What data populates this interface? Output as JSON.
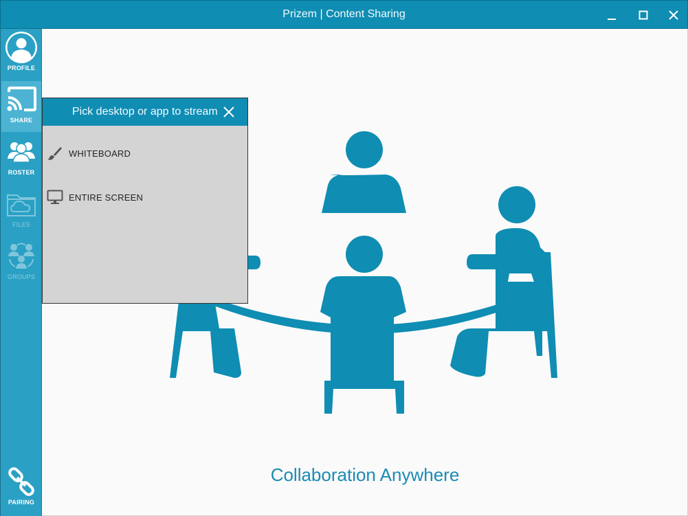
{
  "window": {
    "title": "Prizem | Content Sharing"
  },
  "sidebar": {
    "items": [
      {
        "label": "PROFILE",
        "icon": "profile-icon"
      },
      {
        "label": "SHARE",
        "icon": "cast-icon"
      },
      {
        "label": "ROSTER",
        "icon": "roster-icon"
      },
      {
        "label": "FILES",
        "icon": "cloud-folder-icon"
      },
      {
        "label": "GROUPS",
        "icon": "groups-icon"
      }
    ],
    "bottom": {
      "label": "PAIRING",
      "icon": "link-icon"
    }
  },
  "picker": {
    "title": "Pick desktop or app to stream",
    "items": [
      {
        "label": "WHITEBOARD",
        "icon": "brush-icon"
      },
      {
        "label": "ENTIRE SCREEN",
        "icon": "monitor-icon"
      }
    ]
  },
  "main": {
    "tagline": "Collaboration Anywhere"
  },
  "colors": {
    "accent": "#0f8db3",
    "sidebar": "#2aa0c4",
    "illustration": "#0f8db3"
  }
}
